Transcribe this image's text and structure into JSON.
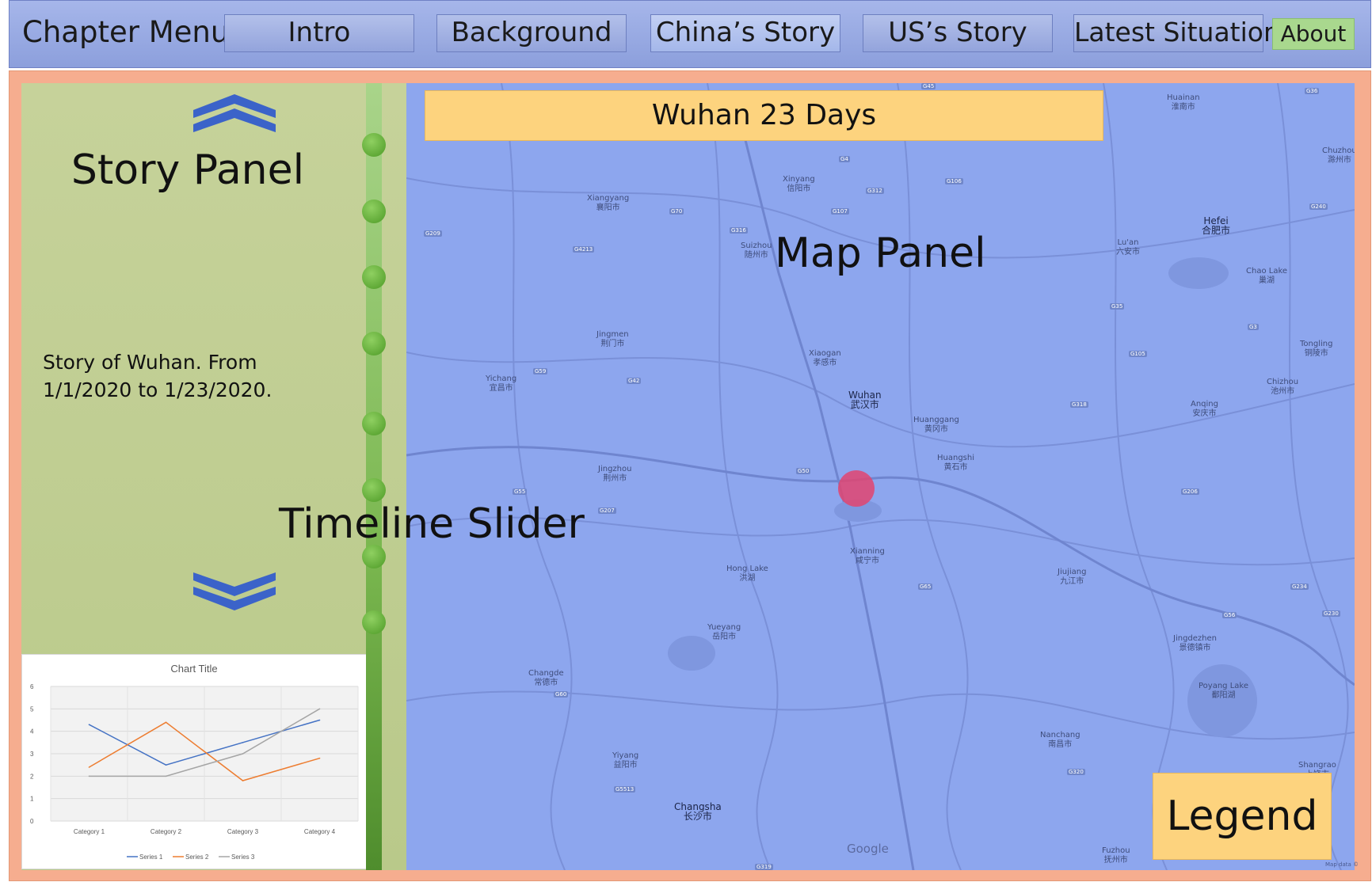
{
  "menu": {
    "title": "Chapter Menu",
    "items": [
      {
        "label": "Intro"
      },
      {
        "label": "Background"
      },
      {
        "label": "China’s Story"
      },
      {
        "label": "US’s Story"
      },
      {
        "label": "Latest Situation"
      }
    ],
    "about": "About",
    "active": "China’s Story"
  },
  "story": {
    "title": "Story Panel",
    "text": "Story of Wuhan. From 1/1/2020 to 1/23/2020."
  },
  "timeline": {
    "label": "Timeline Slider",
    "points": 8
  },
  "map": {
    "banner": "Wuhan 23 Days",
    "title": "Map Panel",
    "legend": "Legend",
    "attribution": "Google",
    "map_data": "Map data ©",
    "marker_city": "Wuhan",
    "cities": [
      {
        "name": "Huainan",
        "zh": "淮南市"
      },
      {
        "name": "Chuzhou",
        "zh": "滁州市"
      },
      {
        "name": "Xinyang",
        "zh": "信阳市"
      },
      {
        "name": "Xiangyang",
        "zh": "襄阳市"
      },
      {
        "name": "Suizhou",
        "zh": "随州市"
      },
      {
        "name": "Hefei",
        "zh": "合肥市"
      },
      {
        "name": "Lu'an",
        "zh": "六安市"
      },
      {
        "name": "Chao Lake",
        "zh": "巢湖"
      },
      {
        "name": "Jingmen",
        "zh": "荆门市"
      },
      {
        "name": "Xiaogan",
        "zh": "孝感市"
      },
      {
        "name": "Tongling",
        "zh": "铜陵市"
      },
      {
        "name": "Yichang",
        "zh": "宜昌市"
      },
      {
        "name": "Wuhan",
        "zh": "武汉市"
      },
      {
        "name": "Huanggang",
        "zh": "黄冈市"
      },
      {
        "name": "Chizhou",
        "zh": "池州市"
      },
      {
        "name": "Anqing",
        "zh": "安庆市"
      },
      {
        "name": "Jingzhou",
        "zh": "荆州市"
      },
      {
        "name": "Huangshi",
        "zh": "黄石市"
      },
      {
        "name": "Xianning",
        "zh": "咸宁市"
      },
      {
        "name": "Hong Lake",
        "zh": "洪湖"
      },
      {
        "name": "Jiujiang",
        "zh": "九江市"
      },
      {
        "name": "Yueyang",
        "zh": "岳阳市"
      },
      {
        "name": "Jingdezhen",
        "zh": "景德镇市"
      },
      {
        "name": "Changde",
        "zh": "常德市"
      },
      {
        "name": "Poyang Lake",
        "zh": "鄱阳湖"
      },
      {
        "name": "Nanchang",
        "zh": "南昌市"
      },
      {
        "name": "Yiyang",
        "zh": "益阳市"
      },
      {
        "name": "Shangrao",
        "zh": "上饶市"
      },
      {
        "name": "Changsha",
        "zh": "长沙市"
      },
      {
        "name": "Fuzhou",
        "zh": "抚州市"
      }
    ],
    "roads": [
      "G45",
      "G36",
      "G4",
      "G312",
      "G107",
      "G106",
      "G316",
      "G70",
      "G50",
      "G55",
      "G42",
      "G318",
      "G35",
      "G3",
      "G60",
      "G105",
      "G56",
      "G65",
      "G320",
      "G5513",
      "G207",
      "G209",
      "G319",
      "G230",
      "G4213",
      "G234",
      "G59",
      "G206",
      "G240"
    ]
  },
  "chart_data": {
    "type": "line",
    "title": "Chart Title",
    "categories": [
      "Category 1",
      "Category 2",
      "Category 3",
      "Category 4"
    ],
    "series": [
      {
        "name": "Series 1",
        "values": [
          4.3,
          2.5,
          3.5,
          4.5
        ],
        "color": "#4472c4"
      },
      {
        "name": "Series 2",
        "values": [
          2.4,
          4.4,
          1.8,
          2.8
        ],
        "color": "#ed7d31"
      },
      {
        "name": "Series 3",
        "values": [
          2,
          2,
          3,
          5
        ],
        "color": "#a5a5a5"
      }
    ],
    "ylim": [
      0,
      6
    ],
    "yticks": [
      "0",
      "1",
      "2",
      "3",
      "4",
      "5",
      "6"
    ],
    "grid": true,
    "legend": "bottom"
  }
}
